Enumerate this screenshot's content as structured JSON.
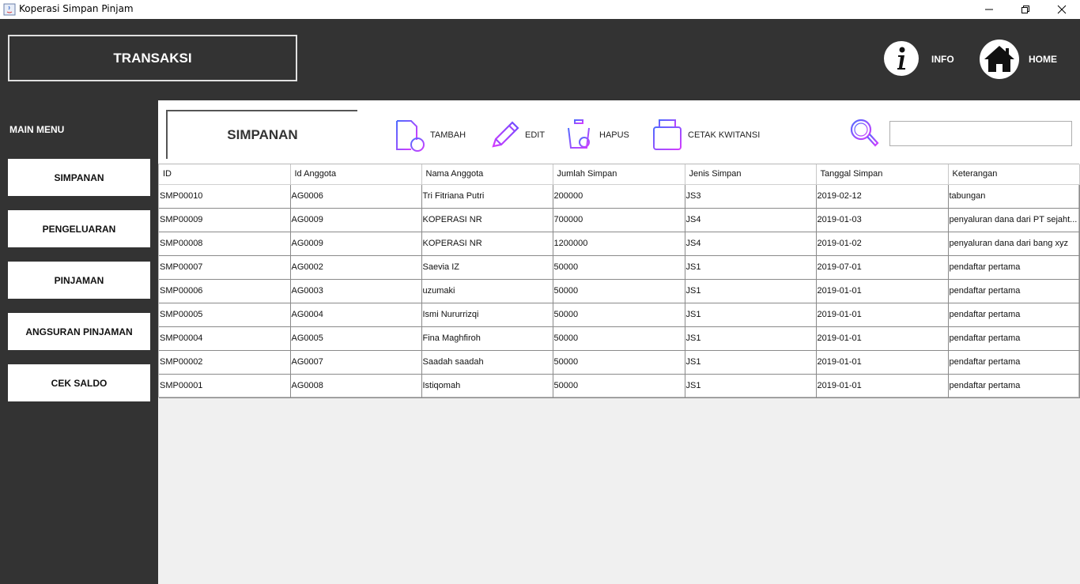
{
  "window": {
    "title": "Koperasi Simpan Pinjam",
    "minimize_icon": "minimize-icon",
    "maximize_icon": "maximize-icon",
    "close_icon": "close-icon"
  },
  "header": {
    "title": "TRANSAKSI",
    "info_label": "INFO",
    "home_label": "HOME"
  },
  "sidebar": {
    "heading": "MAIN MENU",
    "items": [
      {
        "label": "SIMPANAN"
      },
      {
        "label": "PENGELUARAN"
      },
      {
        "label": "PINJAMAN"
      },
      {
        "label": "ANGSURAN PINJAMAN"
      },
      {
        "label": "CEK SALDO"
      }
    ]
  },
  "panel": {
    "title": "SIMPANAN",
    "tools": {
      "tambah": "TAMBAH",
      "edit": "EDIT",
      "hapus": "HAPUS",
      "cetak": "CETAK KWITANSI"
    },
    "search_value": ""
  },
  "table": {
    "columns": [
      "ID",
      "Id Anggota",
      "Nama Anggota",
      "Jumlah Simpan",
      "Jenis Simpan",
      "Tanggal Simpan",
      "Keterangan"
    ],
    "rows": [
      [
        "SMP00010",
        "AG0006",
        "Tri Fitriana Putri",
        "200000",
        "JS3",
        "2019-02-12",
        "tabungan"
      ],
      [
        "SMP00009",
        "AG0009",
        "KOPERASI NR",
        "700000",
        "JS4",
        "2019-01-03",
        "penyaluran dana dari PT sejaht..."
      ],
      [
        "SMP00008",
        "AG0009",
        "KOPERASI NR",
        "1200000",
        "JS4",
        "2019-01-02",
        "penyaluran dana dari bang xyz"
      ],
      [
        "SMP00007",
        "AG0002",
        "Saevia IZ",
        "50000",
        "JS1",
        "2019-07-01",
        "pendaftar pertama"
      ],
      [
        "SMP00006",
        "AG0003",
        "uzumaki",
        "50000",
        "JS1",
        "2019-01-01",
        "pendaftar pertama"
      ],
      [
        "SMP00005",
        "AG0004",
        "Ismi Nururrizqi",
        "50000",
        "JS1",
        "2019-01-01",
        "pendaftar pertama"
      ],
      [
        "SMP00004",
        "AG0005",
        "Fina Maghfiroh",
        "50000",
        "JS1",
        "2019-01-01",
        "pendaftar pertama"
      ],
      [
        "SMP00002",
        "AG0007",
        "Saadah saadah",
        "50000",
        "JS1",
        "2019-01-01",
        "pendaftar pertama"
      ],
      [
        "SMP00001",
        "AG0008",
        "Istiqomah",
        "50000",
        "JS1",
        "2019-01-01",
        "pendaftar pertama"
      ]
    ]
  },
  "colors": {
    "dark_bg": "#333333",
    "content_bg": "#f0f0f0",
    "icon_accent": "#9b4dff"
  }
}
